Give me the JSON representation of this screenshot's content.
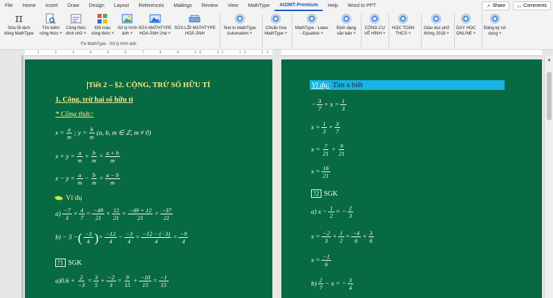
{
  "tabs": [
    "File",
    "Home",
    "Insert",
    "Draw",
    "Design",
    "Layout",
    "References",
    "Mailings",
    "Review",
    "View",
    "MathType",
    "AIOMT-Premium",
    "Help",
    "Word to PPT"
  ],
  "active_tab": "AIOMT-Premium",
  "share_label": "Share",
  "comments_label": "Comments",
  "ribbon": {
    "b1": "Sửa lỗi lệch\ndòng MathType",
    "b2": "Tìm kiếm\ncông thức ˅",
    "b3": "Công thức\ndính chữ ˅",
    "b4": "Đổi màu\ncông thức ˅",
    "b5": "Xử lý hình\nảnh ˅",
    "b6": "SỬA MATHTYPE\nHÓA ẢNH 2nd ˅",
    "b7": "SỬA LỖI MATHTYPE\nHOÁ ẢNH",
    "b8": "Text to MathType\nAutomation ˅",
    "b9": "Chuẩn hóa\nMathType ˅",
    "b10": "MathType - Latex\n- Equation ˅",
    "b11": "Định dạng\nvăn bản ˅",
    "b12": "CÔNG CỤ\nVẼ HÌNH ˅",
    "b13": "HỌC TOÁN\nTHCS ˅",
    "b14": "Giáo dục phổ\nthông 2018 ˅",
    "b15": "DẠY HỌC\nONLINE ˅",
    "b16": "Đăng ký sử\ndụng ˅",
    "group_label": "Fix MathType - Xử lý hình ảnh"
  },
  "ruler": "· 1 · 2 · 3 · 4 · 5 · 6 · 7 · 8 · 9 · 10 · 11 · 12 · 13 · 14 · 15 · 16 · 17 · 18 ·",
  "page1": {
    "title": "Tiết 2 – §2. CỘNG, TRỪ SỐ HỮU TỈ",
    "h1": "1. Cộng, trừ hai số hữu tỉ",
    "h2": "* Công thức:",
    "eq1_pre": "x =",
    "eq1_a": "a",
    "eq1_m": "m",
    "eq1_mid": "; y =",
    "eq1_b": "b",
    "eq1_post": "(a, b, m ∈ ℤ, m ≠ 0)",
    "eq2_pre": "x + y =",
    "eq2_n3": "a + b",
    "eq3_pre": "x − y =",
    "eq3_n3": "a − b",
    "plus": "+",
    "minus": "−",
    "eq": "=",
    "vidu": "Ví dụ",
    "ex_a": "a)",
    "ex_b": "b) − 3 −",
    "a_n1": "−7",
    "a_d1": "3",
    "a_n2": "4",
    "a_d2": "7",
    "a_n3": "−49",
    "a_d3": "21",
    "a_n4": "12",
    "a_d4": "21",
    "a_n5": "−49 + 12",
    "a_d5": "21",
    "a_n6": "−37",
    "a_d6": "21",
    "b_n1": "−3",
    "b_d1": "4",
    "b_n2": "−12",
    "b_d2": "4",
    "b_n3": "−3",
    "b_d3": "4",
    "b_n4": "−12 − (−3)",
    "b_d4": "4",
    "b_n5": "−9",
    "b_d5": "4",
    "q1": "?1",
    "sgk1": "SGK",
    "c_pre": "a)0.6 +",
    "c_n1": "2",
    "c_d1": "−3",
    "c_n2": "3",
    "c_d2": "5",
    "c_n3": "−2",
    "c_d3": "3",
    "c_n4": "9",
    "c_d4": "15",
    "c_n5": "−10",
    "c_d5": "15",
    "c_n6": "−1",
    "c_d6": "15"
  },
  "page2": {
    "vidu": "Ví dụ:",
    "vidu_text": "Tìm x biết",
    "r1_pre": "−",
    "r1_n1": "3",
    "r1_d1": "7",
    "r1_mid": "+ x =",
    "r1_n2": "1",
    "r1_d2": "3",
    "r2_pre": "x =",
    "r2_n1": "1",
    "r2_d1": "3",
    "r2_n2": "3",
    "r2_d2": "7",
    "r3_pre": "x =",
    "r3_n1": "7",
    "r3_d1": "21",
    "r3_n2": "9",
    "r3_d2": "21",
    "r4_pre": "x =",
    "r4_n1": "16",
    "r4_d1": "21",
    "q2": "?2",
    "sgk2": "SGK",
    "s1_pre": "a)  x −",
    "s1_n1": "1",
    "s1_d1": "2",
    "s1_mid": "= −",
    "s1_n2": "2",
    "s1_d2": "3",
    "s2_pre": "x =",
    "s2_n1": "−2",
    "s2_d1": "3",
    "s2_n2": "1",
    "s2_d2": "2",
    "s2_n3": "−4",
    "s2_d3": "6",
    "s2_n4": "3",
    "s2_d4": "6",
    "s3_pre": "x =",
    "s3_n1": "−1",
    "s3_d1": "6",
    "s4_pre": "b)",
    "s4_n1": "2",
    "s4_d1": "7",
    "s4_mid": "− x = −",
    "s4_n2": "3",
    "s4_d2": "4"
  }
}
